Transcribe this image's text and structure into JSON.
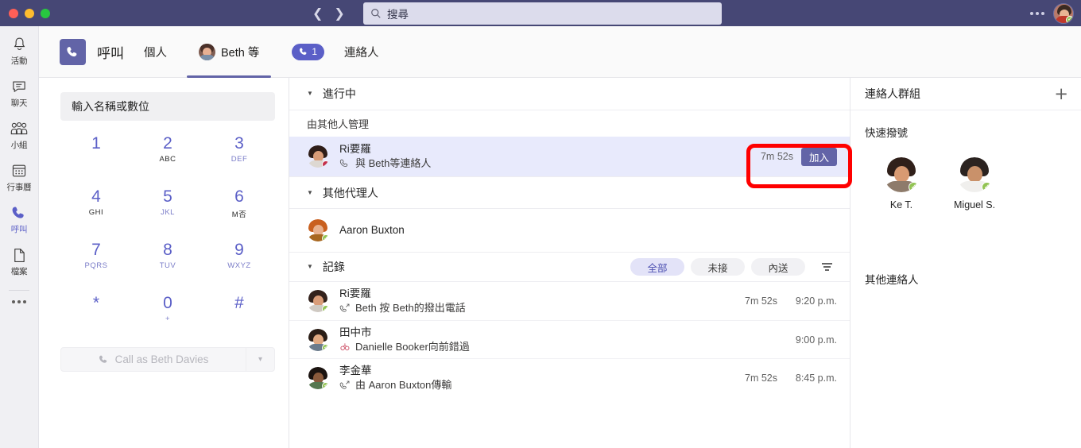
{
  "theme": {
    "brand": "#6264A7",
    "titlebar": "#464775",
    "accent_light": "#E3E3F8",
    "highlight": "#FF0000",
    "presence_available": "#92C353",
    "presence_busy": "#C4314B"
  },
  "titlebar": {
    "back_icon": "chevron-left-icon",
    "forward_icon": "chevron-right-icon",
    "search": {
      "placeholder": "搜尋",
      "value": "",
      "icon": "search-icon"
    },
    "overflow_label": "...",
    "avatar_label": "Beth Davies"
  },
  "rail": {
    "items": [
      {
        "label": "活動",
        "icon": "bell-icon",
        "active": false
      },
      {
        "label": "聊天",
        "icon": "chat-icon",
        "active": false
      },
      {
        "label": "小組",
        "icon": "teams-icon",
        "active": false
      },
      {
        "label": "行事曆",
        "icon": "calendar-icon",
        "active": false
      },
      {
        "label": "呼叫",
        "icon": "phone-icon",
        "active": true
      },
      {
        "label": "檔案",
        "icon": "file-icon",
        "active": false
      }
    ],
    "more_label": "..."
  },
  "tabstrip": {
    "app_icon": "phone-icon",
    "title": "呼叫",
    "tabs": [
      {
        "label": "個人",
        "active": false
      },
      {
        "label": "Beth 等",
        "active": true,
        "avatar": true
      }
    ],
    "badge": {
      "count": "1",
      "icon": "phone-icon"
    },
    "contacts_tab": "連絡人"
  },
  "dialpad": {
    "input_placeholder": "輸入名稱或數位",
    "input_value": "",
    "keys": [
      {
        "num": "1",
        "sub": ""
      },
      {
        "num": "2",
        "sub": "ABC"
      },
      {
        "num": "3",
        "sub": "DEF"
      },
      {
        "num": "4",
        "sub": "GHI"
      },
      {
        "num": "5",
        "sub": "JKL"
      },
      {
        "num": "6",
        "sub": "M否"
      },
      {
        "num": "7",
        "sub": "PQRS"
      },
      {
        "num": "8",
        "sub": "TUV"
      },
      {
        "num": "9",
        "sub": "WXYZ"
      },
      {
        "num": "*",
        "sub": ""
      },
      {
        "num": "0",
        "sub": "+"
      },
      {
        "num": "#",
        "sub": ""
      }
    ],
    "call_as_label": "Call as Beth Davies",
    "call_as_icon": "phone-icon",
    "call_as_chevron": "chevron-down-icon"
  },
  "center": {
    "in_progress_header": "進行中",
    "managed_by_others_header": "由其他人管理",
    "active_call": {
      "name": "Ri要羅",
      "subtitle": "與 Beth等連絡人",
      "sub_icon": "phone-icon",
      "duration": "7m 52s",
      "join_label": "加入",
      "presence": "busy"
    },
    "other_delegates_header": "其他代理人",
    "delegates": [
      {
        "name": "Aaron Buxton",
        "presence": "available"
      }
    ],
    "history_header": "記錄",
    "filters": [
      {
        "label": "全部",
        "active": true
      },
      {
        "label": "未接",
        "active": false
      },
      {
        "label": "內送",
        "active": false
      }
    ],
    "filter_icon": "filter-icon",
    "history": [
      {
        "name": "Ri要羅",
        "subtitle": "Beth 按 Beth的撥出電話",
        "icon": "outgoing-call-icon",
        "duration": "7m 52s",
        "time": "9:20 p.m.",
        "presence": "available"
      },
      {
        "name": "田中市",
        "subtitle": "Danielle Booker向前錯過",
        "icon": "missed-call-icon",
        "duration": "",
        "time": "9:00 p.m.",
        "presence": "available"
      },
      {
        "name": "李金華",
        "subtitle": "由 Aaron Buxton傳輸",
        "icon": "outgoing-call-icon",
        "duration": "7m 52s",
        "time": "8:45 p.m.",
        "presence": "available"
      }
    ]
  },
  "right": {
    "header": "連絡人群組",
    "add_icon": "plus-icon",
    "speed_dial_header": "快速撥號",
    "speed_dial": [
      {
        "name": "Ke T.",
        "presence": "available"
      },
      {
        "name": "Miguel S.",
        "presence": "available"
      }
    ],
    "other_contacts_header": "其他連絡人"
  }
}
